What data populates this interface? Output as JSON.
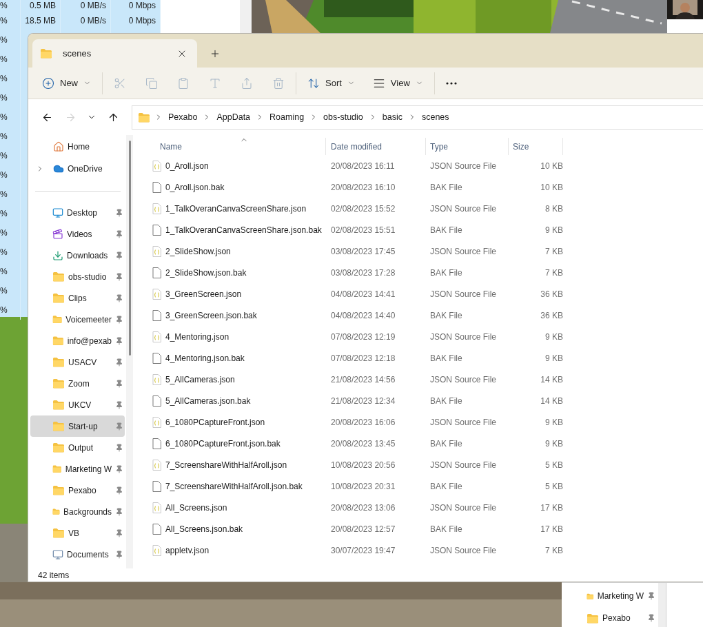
{
  "task_manager": {
    "rows": [
      {
        "cpu": "%",
        "memory": "0.5 MB",
        "disk": "0 MB/s",
        "network": "0 Mbps"
      },
      {
        "cpu": "%",
        "memory": "18.5 MB",
        "disk": "0 MB/s",
        "network": "0 Mbps"
      },
      {
        "cpu": "%"
      },
      {
        "cpu": "%"
      },
      {
        "cpu": "%"
      },
      {
        "cpu": "%"
      },
      {
        "cpu": "%"
      },
      {
        "cpu": "%"
      },
      {
        "cpu": "%"
      },
      {
        "cpu": "%"
      },
      {
        "cpu": "%"
      },
      {
        "cpu": "%"
      },
      {
        "cpu": "%"
      },
      {
        "cpu": "%"
      },
      {
        "cpu": "%"
      },
      {
        "cpu": "%"
      },
      {
        "cpu": "%"
      }
    ]
  },
  "explorer": {
    "tab": {
      "title": "scenes",
      "selected": true
    },
    "toolbar": [
      {
        "kind": "new",
        "label": "New",
        "disabled": false
      },
      {
        "kind": "cut",
        "disabled": true
      },
      {
        "kind": "copy",
        "disabled": true
      },
      {
        "kind": "paste",
        "disabled": true
      },
      {
        "kind": "rename",
        "disabled": true
      },
      {
        "kind": "share",
        "disabled": true
      },
      {
        "kind": "delete",
        "disabled": true
      },
      {
        "kind": "sort",
        "label": "Sort",
        "disabled": false
      },
      {
        "kind": "view",
        "label": "View",
        "disabled": false
      },
      {
        "kind": "more",
        "disabled": false
      }
    ],
    "nav": [
      {
        "kind": "back",
        "disabled": false
      },
      {
        "kind": "forward",
        "disabled": true
      },
      {
        "kind": "recent",
        "disabled": false
      },
      {
        "kind": "up",
        "disabled": false
      }
    ],
    "breadcrumb": [
      "Pexabo",
      "AppData",
      "Roaming",
      "obs-studio",
      "basic",
      "scenes"
    ],
    "sidebar": {
      "top": [
        {
          "label": "Home",
          "kind": "home",
          "selected": false
        },
        {
          "label": "OneDrive",
          "kind": "cloud",
          "selected": false,
          "expanded": false
        }
      ],
      "pinned": [
        {
          "label": "Desktop",
          "kind": "desktop",
          "pinned": true,
          "selected": false
        },
        {
          "label": "Videos",
          "kind": "videos",
          "pinned": true,
          "selected": false
        },
        {
          "label": "Downloads",
          "kind": "downloads",
          "pinned": true,
          "selected": false
        },
        {
          "label": "obs-studio",
          "kind": "folder",
          "pinned": true,
          "selected": false
        },
        {
          "label": "Clips",
          "kind": "folder",
          "pinned": true,
          "selected": false
        },
        {
          "label": "Voicemeeter",
          "kind": "folder",
          "pinned": true,
          "selected": false
        },
        {
          "label": "info@pexab",
          "kind": "folder",
          "pinned": true,
          "selected": false
        },
        {
          "label": "USACV",
          "kind": "folder",
          "pinned": true,
          "selected": false
        },
        {
          "label": "Zoom",
          "kind": "folder",
          "pinned": true,
          "selected": false
        },
        {
          "label": "UKCV",
          "kind": "folder",
          "pinned": true,
          "selected": false
        },
        {
          "label": "Start-up",
          "kind": "folder",
          "pinned": true,
          "selected": true
        },
        {
          "label": "Output",
          "kind": "folder",
          "pinned": true,
          "selected": false
        },
        {
          "label": "Marketing W",
          "kind": "folder",
          "pinned": true,
          "selected": false
        },
        {
          "label": "Pexabo",
          "kind": "folder",
          "pinned": true,
          "selected": false
        },
        {
          "label": "Backgrounds",
          "kind": "folder",
          "pinned": true,
          "selected": false
        },
        {
          "label": "VB",
          "kind": "folder",
          "pinned": true,
          "selected": false
        },
        {
          "label": "Documents",
          "kind": "documents",
          "pinned": true,
          "selected": false
        }
      ]
    },
    "columns": [
      {
        "label": "Name",
        "sorted": true
      },
      {
        "label": "Date modified",
        "sorted": false
      },
      {
        "label": "Type",
        "sorted": false
      },
      {
        "label": "Size",
        "sorted": false
      }
    ],
    "files": [
      {
        "name": "0_Aroll.json",
        "date": "20/08/2023 16:11",
        "type": "JSON Source File",
        "size": "10 KB",
        "kind": "json"
      },
      {
        "name": "0_Aroll.json.bak",
        "date": "20/08/2023 16:10",
        "type": "BAK File",
        "size": "10 KB",
        "kind": "bak"
      },
      {
        "name": "1_TalkOveranCanvaScreenShare.json",
        "date": "02/08/2023 15:52",
        "type": "JSON Source File",
        "size": "8 KB",
        "kind": "json"
      },
      {
        "name": "1_TalkOveranCanvaScreenShare.json.bak",
        "date": "02/08/2023 15:51",
        "type": "BAK File",
        "size": "9 KB",
        "kind": "bak"
      },
      {
        "name": "2_SlideShow.json",
        "date": "03/08/2023 17:45",
        "type": "JSON Source File",
        "size": "7 KB",
        "kind": "json"
      },
      {
        "name": "2_SlideShow.json.bak",
        "date": "03/08/2023 17:28",
        "type": "BAK File",
        "size": "7 KB",
        "kind": "bak"
      },
      {
        "name": "3_GreenScreen.json",
        "date": "04/08/2023 14:41",
        "type": "JSON Source File",
        "size": "36 KB",
        "kind": "json"
      },
      {
        "name": "3_GreenScreen.json.bak",
        "date": "04/08/2023 14:40",
        "type": "BAK File",
        "size": "36 KB",
        "kind": "bak"
      },
      {
        "name": "4_Mentoring.json",
        "date": "07/08/2023 12:19",
        "type": "JSON Source File",
        "size": "9 KB",
        "kind": "json"
      },
      {
        "name": "4_Mentoring.json.bak",
        "date": "07/08/2023 12:18",
        "type": "BAK File",
        "size": "9 KB",
        "kind": "bak"
      },
      {
        "name": "5_AllCameras.json",
        "date": "21/08/2023 14:56",
        "type": "JSON Source File",
        "size": "14 KB",
        "kind": "json"
      },
      {
        "name": "5_AllCameras.json.bak",
        "date": "21/08/2023 12:34",
        "type": "BAK File",
        "size": "14 KB",
        "kind": "bak"
      },
      {
        "name": "6_1080PCaptureFront.json",
        "date": "20/08/2023 16:06",
        "type": "JSON Source File",
        "size": "9 KB",
        "kind": "json"
      },
      {
        "name": "6_1080PCaptureFront.json.bak",
        "date": "20/08/2023 13:45",
        "type": "BAK File",
        "size": "9 KB",
        "kind": "bak"
      },
      {
        "name": "7_ScreenshareWithHalfAroll.json",
        "date": "10/08/2023 20:56",
        "type": "JSON Source File",
        "size": "5 KB",
        "kind": "json"
      },
      {
        "name": "7_ScreenshareWithHalfAroll.json.bak",
        "date": "10/08/2023 20:31",
        "type": "BAK File",
        "size": "5 KB",
        "kind": "bak"
      },
      {
        "name": "All_Screens.json",
        "date": "20/08/2023 13:06",
        "type": "JSON Source File",
        "size": "17 KB",
        "kind": "json"
      },
      {
        "name": "All_Screens.json.bak",
        "date": "20/08/2023 12:57",
        "type": "BAK File",
        "size": "17 KB",
        "kind": "bak"
      },
      {
        "name": "appletv.json",
        "date": "30/07/2023 19:47",
        "type": "JSON Source File",
        "size": "7 KB",
        "kind": "json"
      }
    ],
    "status_bar": "42 items"
  },
  "background_explorer": {
    "sidebar": [
      {
        "label": "Marketing W",
        "kind": "folder",
        "pinned": true
      },
      {
        "label": "Pexabo",
        "kind": "folder",
        "pinned": true
      }
    ]
  }
}
